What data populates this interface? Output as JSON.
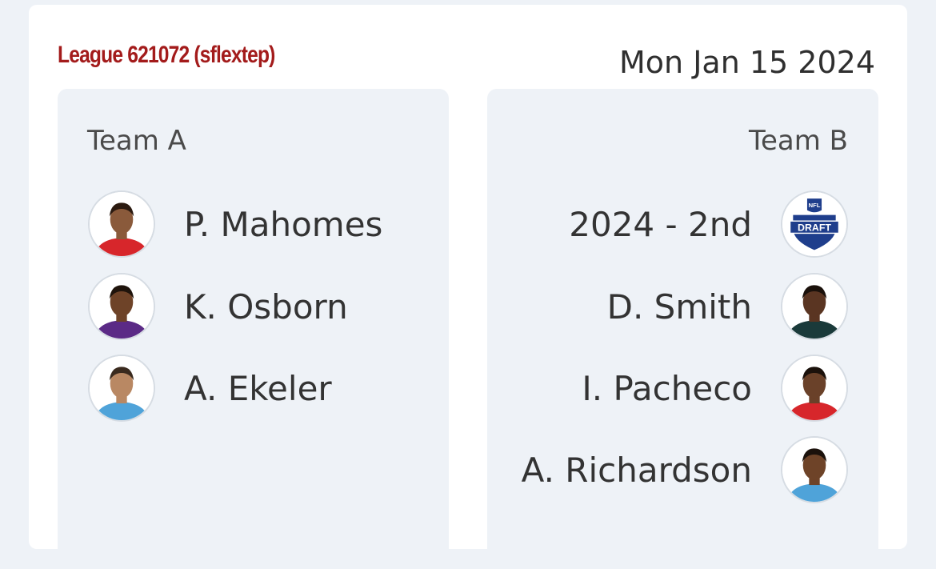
{
  "header": {
    "league": "League 621072 (sflextep)",
    "date": "Mon Jan 15 2024"
  },
  "team_a": {
    "name": "Team A",
    "players": [
      {
        "name": "P. Mahomes",
        "jersey_color": "#d7262b",
        "skin": "#8a5a3b",
        "hair": "#2b1a10"
      },
      {
        "name": "K. Osborn",
        "jersey_color": "#5b2a86",
        "skin": "#6e4328",
        "hair": "#1f140c"
      },
      {
        "name": "A. Ekeler",
        "jersey_color": "#4fa3d9",
        "skin": "#b98863",
        "hair": "#3a2a1e"
      }
    ]
  },
  "team_b": {
    "name": "Team B",
    "assets": [
      {
        "name": "2024 - 2nd",
        "type": "draft-pick",
        "logo_text": "DRAFT",
        "logo_top": "NFL"
      },
      {
        "name": "D. Smith",
        "jersey_color": "#1a3a3a",
        "skin": "#5a3522",
        "hair": "#1b110b"
      },
      {
        "name": "I. Pacheco",
        "jersey_color": "#d7262b",
        "skin": "#6a4129",
        "hair": "#1b110b"
      },
      {
        "name": "A. Richardson",
        "jersey_color": "#4fa3d9",
        "skin": "#6e4328",
        "hair": "#1b110b"
      }
    ]
  }
}
